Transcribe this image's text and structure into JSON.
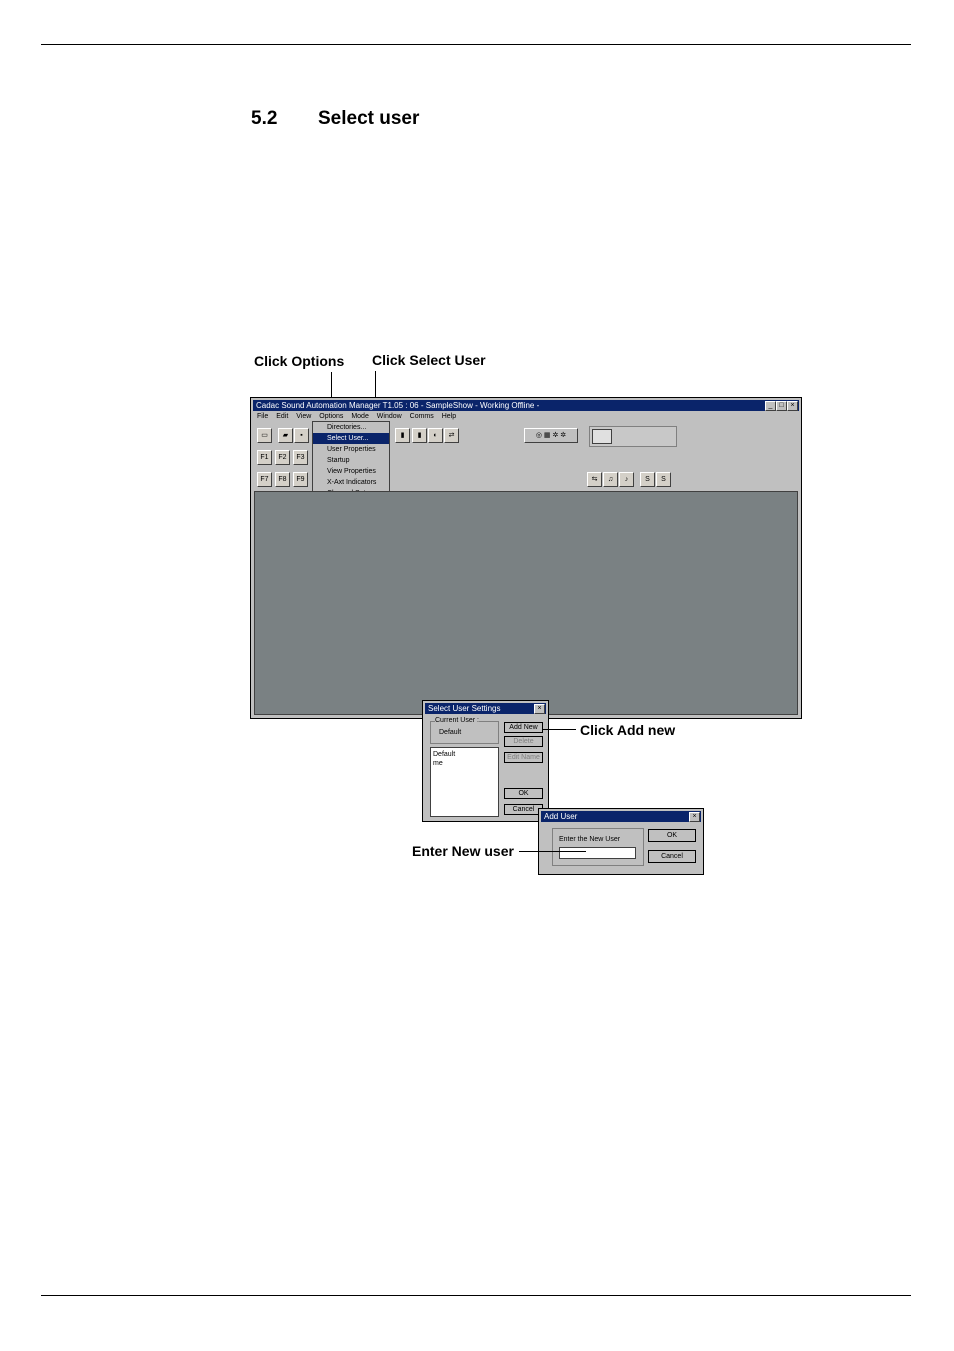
{
  "section": {
    "number": "5.2",
    "title": "Select user"
  },
  "callouts": {
    "options": "Click Options",
    "select_user": "Click Select User",
    "add_new": "Click Add new",
    "enter_new_user": "Enter New user"
  },
  "main_window": {
    "title": "Cadac Sound Automation Manager T1.05 : 06 - SampleShow   - Working Offline -",
    "menus": [
      "File",
      "Edit",
      "View",
      "Options",
      "Mode",
      "Window",
      "Comms",
      "Help"
    ],
    "options_menu": [
      "Directories...",
      "Select User...",
      "User Properties",
      "Startup",
      "View Properties",
      "X-Axt Indicators",
      "Channel Sets"
    ],
    "selected_menu_item": "Select User..."
  },
  "select_user_dialog": {
    "title": "Select User Settings",
    "current_user_label": "Current User :",
    "current_user": "Default",
    "users": [
      "Default",
      "me"
    ],
    "add_new": "Add New",
    "delete": "Delete",
    "edit_name": "Edit Name",
    "ok": "OK",
    "cancel": "Cancel"
  },
  "add_user_dialog": {
    "title": "Add User",
    "prompt": "Enter the New User",
    "ok": "OK",
    "cancel": "Cancel"
  }
}
